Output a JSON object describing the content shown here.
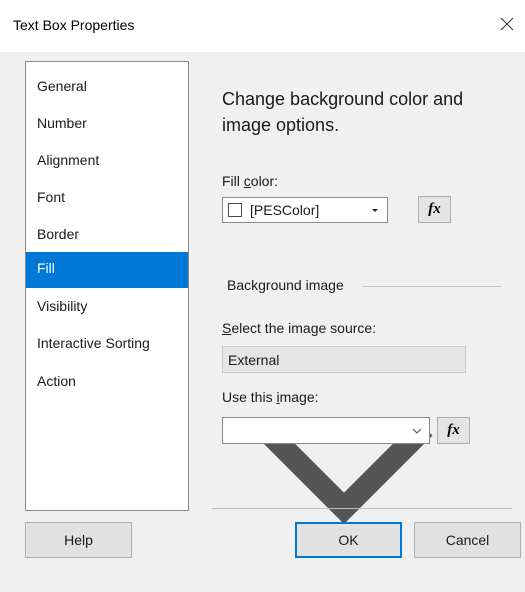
{
  "window": {
    "title": "Text Box Properties",
    "close_icon": "close-icon"
  },
  "sidebar": {
    "items": [
      {
        "label": "General",
        "selected": false
      },
      {
        "label": "Number",
        "selected": false
      },
      {
        "label": "Alignment",
        "selected": false
      },
      {
        "label": "Font",
        "selected": false
      },
      {
        "label": "Border",
        "selected": false
      },
      {
        "label": "Fill",
        "selected": true
      },
      {
        "label": "Visibility",
        "selected": false
      },
      {
        "label": "Interactive Sorting",
        "selected": false
      },
      {
        "label": "Action",
        "selected": false
      }
    ]
  },
  "main": {
    "heading": "Change background color and image options.",
    "fill_color": {
      "label_pre": "Fill ",
      "label_accel": "c",
      "label_post": "olor:",
      "value": "[PESColor]",
      "swatch_color": "#ffffff",
      "fx_label": "fx"
    },
    "background_image": {
      "section_label": "Background image",
      "source_label_accel": "S",
      "source_label_post": "elect the image source:",
      "source_value": "External",
      "use_label_pre": "Use this ",
      "use_label_accel": "i",
      "use_label_post": "mage:",
      "use_value": "",
      "fx_label": "fx"
    }
  },
  "footer": {
    "help_label": "Help",
    "ok_label": "OK",
    "cancel_label": "Cancel"
  },
  "colors": {
    "selection": "#0078d7",
    "dialog_bg": "#f0f0f0"
  }
}
